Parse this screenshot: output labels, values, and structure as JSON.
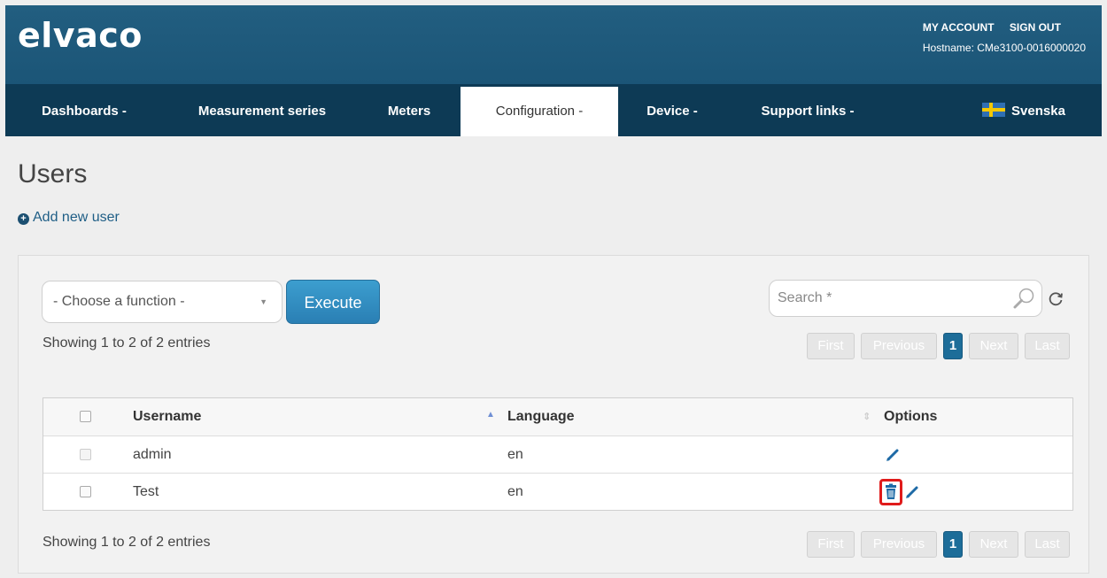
{
  "header": {
    "logo": "elvaco",
    "my_account": "MY ACCOUNT",
    "sign_out": "SIGN OUT",
    "hostname": "Hostname: CMe3100-0016000020"
  },
  "nav": {
    "dashboards": "Dashboards -",
    "measurement_series": "Measurement series",
    "meters": "Meters",
    "configuration": "Configuration -",
    "device": "Device -",
    "support_links": "Support links -",
    "language": "Svenska"
  },
  "page": {
    "title": "Users",
    "add_user": "Add new user"
  },
  "toolbar": {
    "select_value": "- Choose a function -",
    "execute_label": "Execute",
    "search_placeholder": "Search *"
  },
  "info": {
    "showing_top": "Showing 1 to 2 of 2 entries",
    "showing_bottom": "Showing 1 to 2 of 2 entries"
  },
  "pager": {
    "first": "First",
    "previous": "Previous",
    "current": "1",
    "next": "Next",
    "last": "Last"
  },
  "table": {
    "columns": {
      "username": "Username",
      "language": "Language",
      "options": "Options"
    },
    "rows": [
      {
        "username": "admin",
        "language": "en"
      },
      {
        "username": "Test",
        "language": "en"
      }
    ]
  },
  "colors": {
    "header_bg": "#1f5a7c",
    "nav_bg": "#0d3a55",
    "accent": "#2a8fc6",
    "highlight": "#e01b1b"
  },
  "icons": [
    "plus-circle-icon",
    "caret-down-icon",
    "magnifier-icon",
    "refresh-icon",
    "sort-asc-icon",
    "sort-both-icon",
    "pencil-icon",
    "trash-icon",
    "swedish-flag-icon"
  ]
}
